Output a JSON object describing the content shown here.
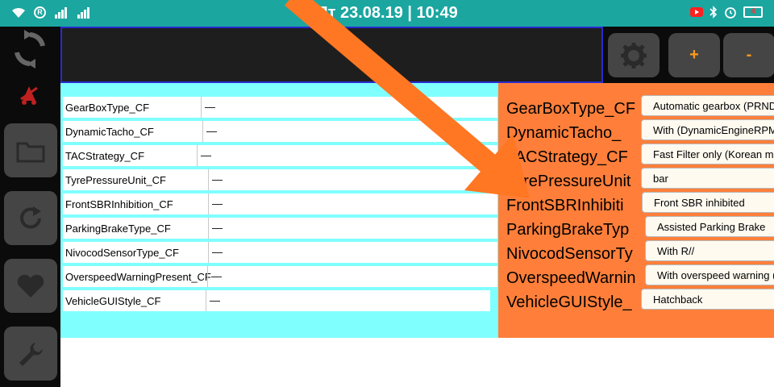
{
  "status_bar": {
    "clock": "Пт 23.08.19 | 10:49",
    "sim_badge": "R",
    "battery_text": "4"
  },
  "toolbar": {
    "plus_label": "+",
    "minus_label": "-"
  },
  "left_table": {
    "rows": [
      {
        "name": "GearBoxType_CF",
        "value": "—"
      },
      {
        "name": "DynamicTacho_CF",
        "value": "—"
      },
      {
        "name": "TACStrategy_CF",
        "value": "—"
      },
      {
        "name": "TyrePressureUnit_CF",
        "value": "—"
      },
      {
        "name": "FrontSBRInhibition_CF",
        "value": "—"
      },
      {
        "name": "ParkingBrakeType_CF",
        "value": "—"
      },
      {
        "name": "NivocodSensorType_CF",
        "value": "—"
      },
      {
        "name": "OverspeedWarningPresent_CF",
        "value": "—"
      },
      {
        "name": "VehicleGUIStyle_CF",
        "value": "—"
      }
    ]
  },
  "right_table": {
    "rows": [
      {
        "label": "GearBoxType_CF",
        "value": "Automatic gearbox (PRND"
      },
      {
        "label": "DynamicTacho_",
        "value": "With (DynamicEngineRPM)"
      },
      {
        "label": "TACStrategy_CF",
        "value": "Fast Filter only (Korean ma"
      },
      {
        "label": "TyrePressureUnit",
        "value": "bar"
      },
      {
        "label": "FrontSBRInhibiti",
        "value": "Front SBR inhibited"
      },
      {
        "label": "ParkingBrakeTyp",
        "value": "Assisted Parking Brake"
      },
      {
        "label": "NivocodSensorTy",
        "value": "With R//"
      },
      {
        "label": "OverspeedWarnin",
        "value": "With overspeed warning ("
      },
      {
        "label": "VehicleGUIStyle_",
        "value": "Hatchback"
      }
    ]
  },
  "colors": {
    "status_bar": "#1ba6a0",
    "left_panel": "#80ffff",
    "right_panel": "#ff7f3a",
    "arrow": "#ff7722",
    "accent": "#ff9a1a"
  }
}
